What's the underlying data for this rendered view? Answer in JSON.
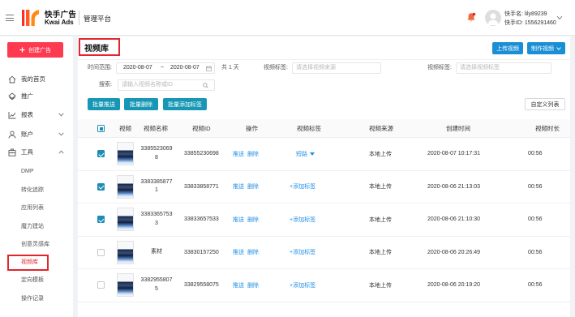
{
  "colors": {
    "brand_red": "#fe3a50",
    "highlight_red": "#e3262e",
    "primary_blue": "#1a8fd6",
    "teal": "#1797b5",
    "link_blue": "#1f8fe8",
    "page_bg": "#f0f2f5"
  },
  "header": {
    "brand_cn": "快手广告",
    "brand_en": "Kwai Ads",
    "platform": "管理平台",
    "user_name": "快手名: lily89239",
    "user_id": "快手ID: 1556291460",
    "icons": [
      "hamburger-icon",
      "kwai-logo-icon",
      "bell-icon",
      "avatar-icon",
      "chevron-down-icon"
    ]
  },
  "sidebar": {
    "create_button": "创建广告",
    "menu": [
      {
        "label": "我的首页",
        "icon": "home-icon"
      },
      {
        "label": "推广",
        "icon": "promotion-icon"
      },
      {
        "label": "报表",
        "icon": "report-icon",
        "expandable": true,
        "expanded": false
      },
      {
        "label": "账户",
        "icon": "account-icon",
        "expandable": true,
        "expanded": false
      },
      {
        "label": "工具",
        "icon": "tools-icon",
        "expandable": true,
        "expanded": true
      }
    ],
    "tools_submenu": [
      "DMP",
      "转化追踪",
      "应用列表",
      "魔力建站",
      "创意灵感库",
      "视频库",
      "定向模板",
      "操作记录"
    ],
    "active_submenu_index": 5
  },
  "main": {
    "title": "视频库",
    "upload_button": "上传视频",
    "make_button": "制作视频",
    "filters": {
      "time_label": "时间范围:",
      "date_start": "2020-08-07",
      "date_sep": "~",
      "date_end": "2020-08-07",
      "days": "共 1 天",
      "source_label": "视频标签:",
      "source_placeholder": "请选择视频来源",
      "tag_label": "视频标签:",
      "tag_placeholder": "请选择视频标签",
      "search_label": "搜索:",
      "search_placeholder": "请输入视频名称或ID"
    },
    "actions": {
      "batch_push": "批量推送",
      "batch_delete": "批量删除",
      "batch_add_tag": "批量添加标签",
      "custom_columns": "自定义列表"
    },
    "table": {
      "some_selected": true,
      "columns": [
        "视频",
        "视频名称",
        "视频ID",
        "操作",
        "视频标签",
        "视频来源",
        "创建时间",
        "视频时长"
      ],
      "rows": [
        {
          "checked": true,
          "name": "33855230698",
          "id": "33855230698",
          "push": "推送",
          "delete": "删除",
          "tag": "短路",
          "tag_dropdown": true,
          "source": "本地上传",
          "created": "2020-08-07 10:17:31",
          "duration": "00:56"
        },
        {
          "checked": true,
          "name": "33833858771",
          "id": "33833858771",
          "push": "推送",
          "delete": "删除",
          "tag": "+添加标签",
          "tag_dropdown": false,
          "source": "本地上传",
          "created": "2020-08-06 21:13:03",
          "duration": "00:56"
        },
        {
          "checked": true,
          "name": "33833657533",
          "id": "33833657533",
          "push": "推送",
          "delete": "删除",
          "tag": "+添加标签",
          "tag_dropdown": false,
          "source": "本地上传",
          "created": "2020-08-06 21:10:30",
          "duration": "00:56"
        },
        {
          "checked": false,
          "name": "素材",
          "id": "33830157250",
          "push": "推送",
          "delete": "删除",
          "tag": "+添加标签",
          "tag_dropdown": false,
          "source": "本地上传",
          "created": "2020-08-06 20:26:49",
          "duration": "00:56"
        },
        {
          "checked": false,
          "name": "33829558075",
          "id": "33829558075",
          "push": "推送",
          "delete": "删除",
          "tag": "+添加标签",
          "tag_dropdown": false,
          "source": "本地上传",
          "created": "2020-08-06 20:19:20",
          "duration": "00:56"
        }
      ]
    }
  }
}
